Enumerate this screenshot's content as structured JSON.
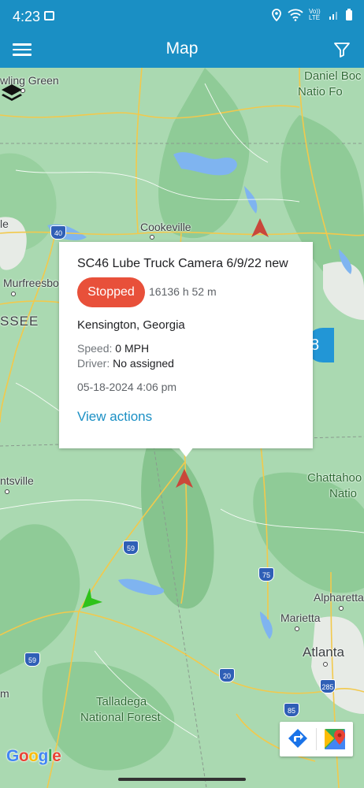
{
  "status_bar": {
    "time": "4:23",
    "icons": [
      "gallery-icon",
      "location-icon",
      "wifi-icon",
      "volte-icon",
      "signal-icon",
      "battery-icon"
    ],
    "volte_text": "Vo)) LTE"
  },
  "app_bar": {
    "title": "Map",
    "menu_icon": "hamburger-menu-icon",
    "filter_icon": "filter-icon",
    "color": "#1a8fc4"
  },
  "map": {
    "places": {
      "bowling_green": "wling Green",
      "daniel_boone_1": "Daniel Boc",
      "daniel_boone_2": "Natio",
      "daniel_boone_3": "Fo",
      "cookeville": "Cookeville",
      "murfreesboro": "Murfreesbo",
      "tennessee": "SSEE",
      "left_e": "le",
      "huntsville": "ntsville",
      "chattahoochee_1": "Chattahoo",
      "chattahoochee_2": "Natio",
      "alpharetta": "Alpharetta",
      "marietta": "Marietta",
      "atlanta": "Atlanta",
      "talladega_1": "Talladega",
      "talladega_2": "National Forest",
      "left_m": "m"
    },
    "shields": [
      "40",
      "59",
      "75",
      "59",
      "20",
      "285",
      "85"
    ],
    "cluster_count": "8",
    "google_text": "Google",
    "marker_colors": {
      "stopped": "#c9473a",
      "moving": "#2ec21a"
    }
  },
  "popup": {
    "title": "SC46 Lube Truck Camera 6/9/22 new",
    "status": "Stopped",
    "status_color": "#e8503a",
    "duration": "16136 h 52 m",
    "location": "Kensington, Georgia",
    "speed_label": "Speed:",
    "speed_value": "0 MPH",
    "driver_label": "Driver:",
    "driver_value": "No assigned",
    "datetime": "05-18-2024 4:06 pm",
    "actions_label": "View actions"
  }
}
